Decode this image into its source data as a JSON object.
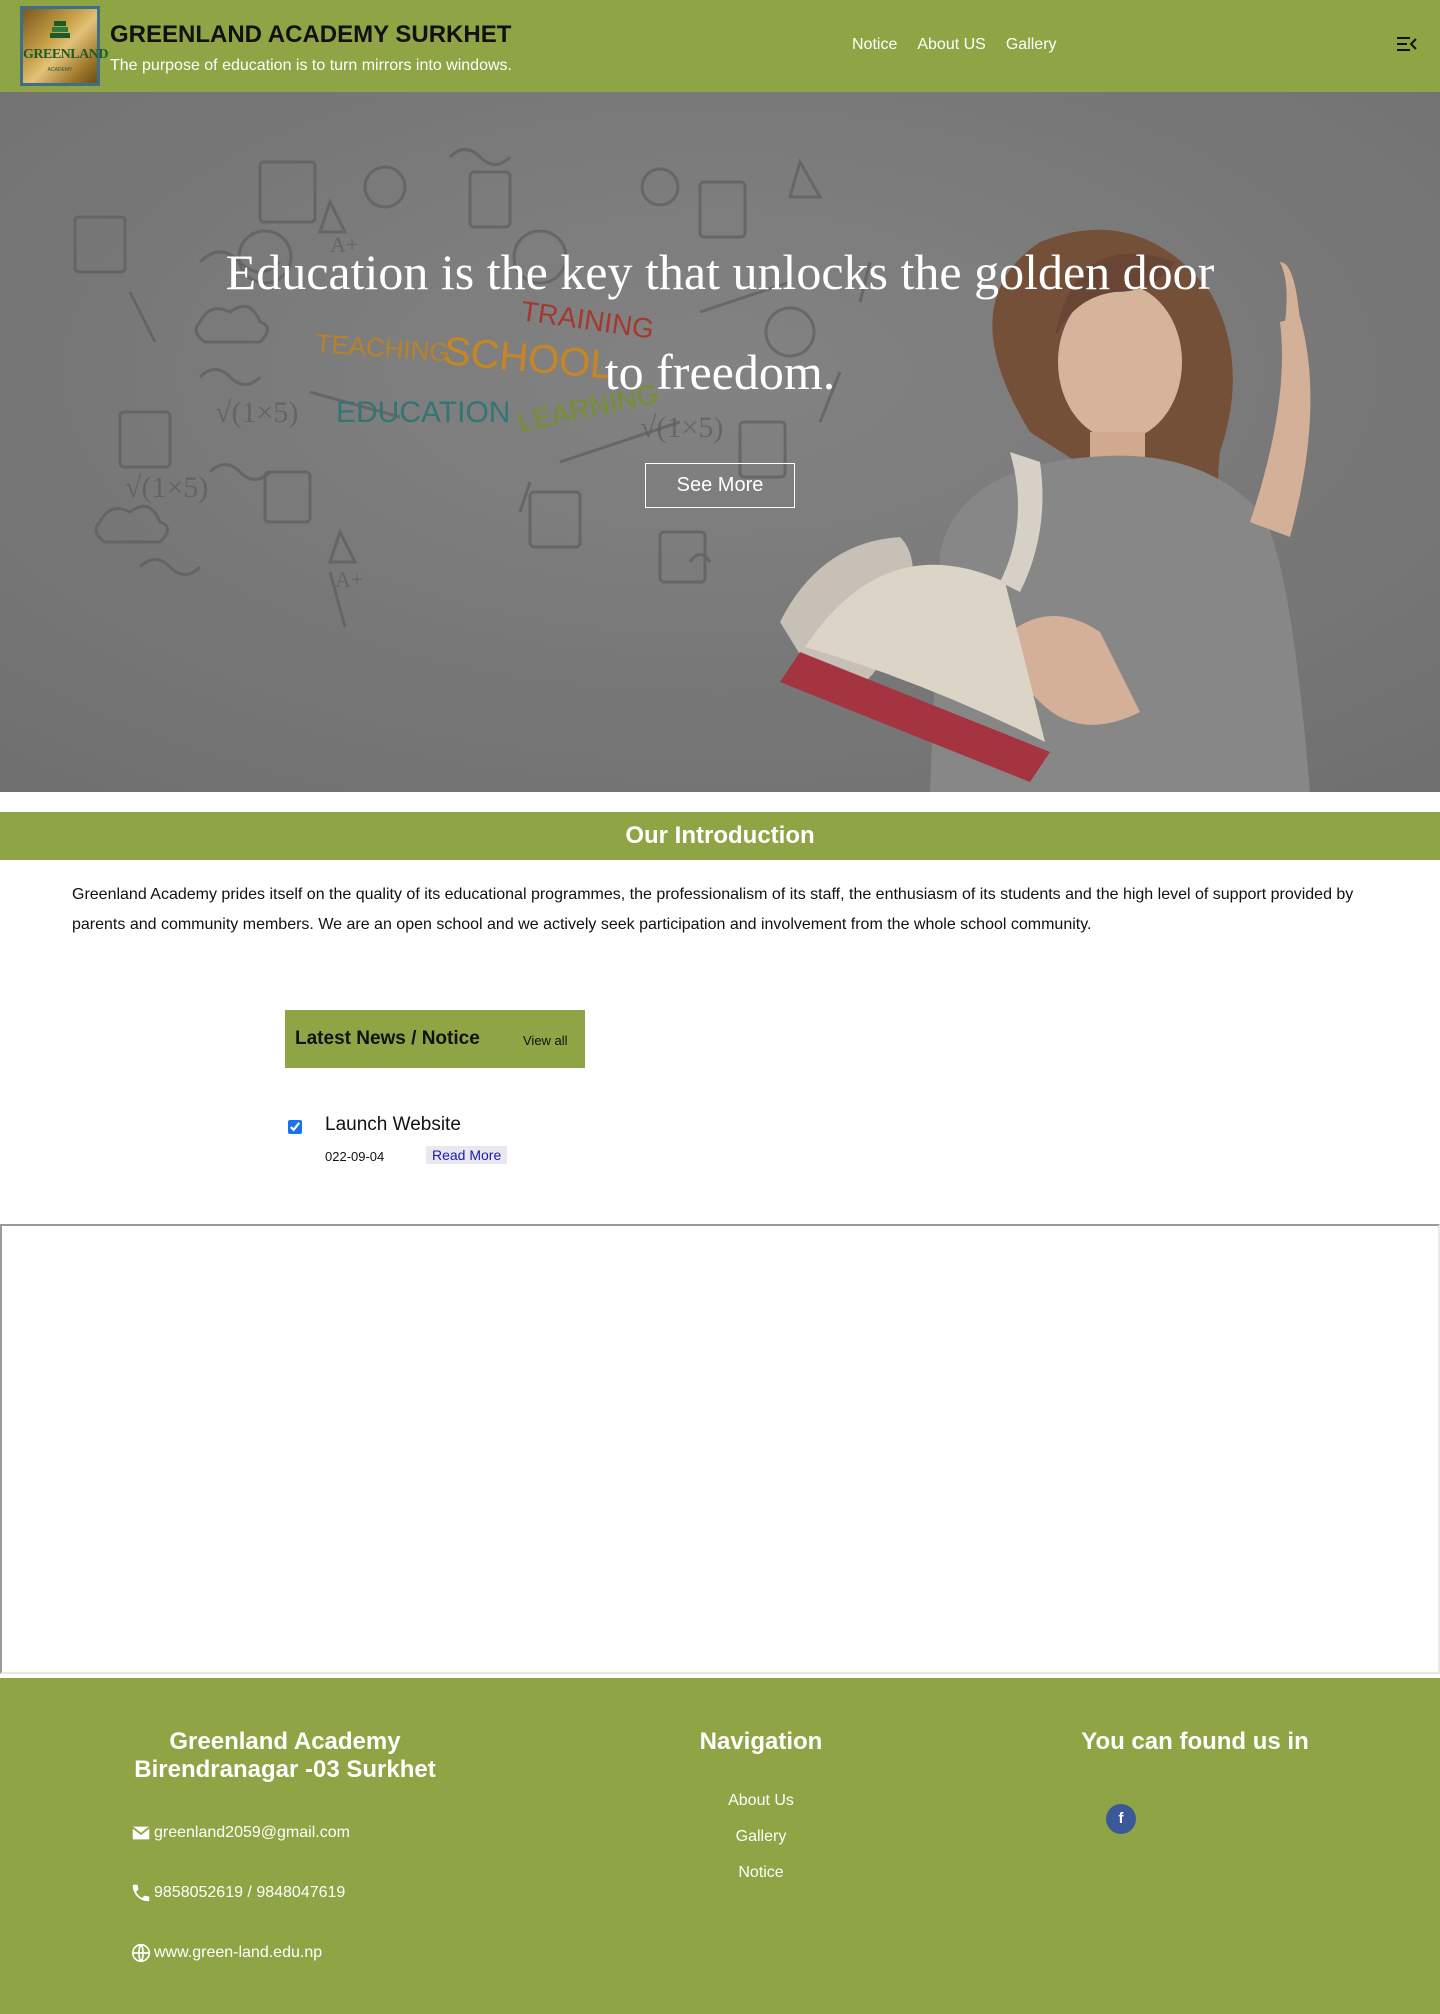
{
  "header": {
    "logo_text": "GREENLAND",
    "logo_subtext": "ACADEMY",
    "title": "GREENLAND ACADEMY SURKHET",
    "tagline": "The purpose of education is to turn mirrors into windows.",
    "nav": [
      "Notice",
      "About US",
      "Gallery"
    ],
    "menu_icon": "menu-collapse-icon"
  },
  "hero": {
    "headline": "Education is the key that unlocks the golden door to freedom.",
    "button_label": "See More",
    "doodle_words": [
      "TEACHING",
      "SCHOOL",
      "TRAINING",
      "EDUCATION",
      "LEARNING"
    ]
  },
  "introduction": {
    "title": "Our Introduction",
    "body": "Greenland Academy prides itself on the quality of its educational programmes, the professionalism of its staff, the enthusiasm of its students and the high level of support provided by parents and community members. We are an open school and we actively seek participation and involvement from the whole school community."
  },
  "news": {
    "title": "Latest News / Notice",
    "view_all": "View all",
    "items": [
      {
        "title": "Launch Website",
        "date": "022-09-04",
        "read_more": "Read More",
        "checked": true
      }
    ]
  },
  "footer": {
    "school_name": "Greenland Academy Birendranagar -03 Surkhet",
    "contacts": [
      {
        "icon": "mail-icon",
        "text": "greenland2059@gmail.com"
      },
      {
        "icon": "phone-icon",
        "text": "9858052619 / 9848047619"
      },
      {
        "icon": "globe-icon",
        "text": "www.green-land.edu.np"
      }
    ],
    "nav_title": "Navigation",
    "nav_links": [
      "About Us",
      "Gallery",
      "Notice"
    ],
    "social_title": "You can found us in",
    "social": [
      {
        "icon": "facebook-icon",
        "label": "f"
      }
    ]
  },
  "colors": {
    "brand_green": "#8fa545",
    "white": "#ffffff",
    "facebook_blue": "#3b5998",
    "link_blue": "#1a1ab0"
  }
}
